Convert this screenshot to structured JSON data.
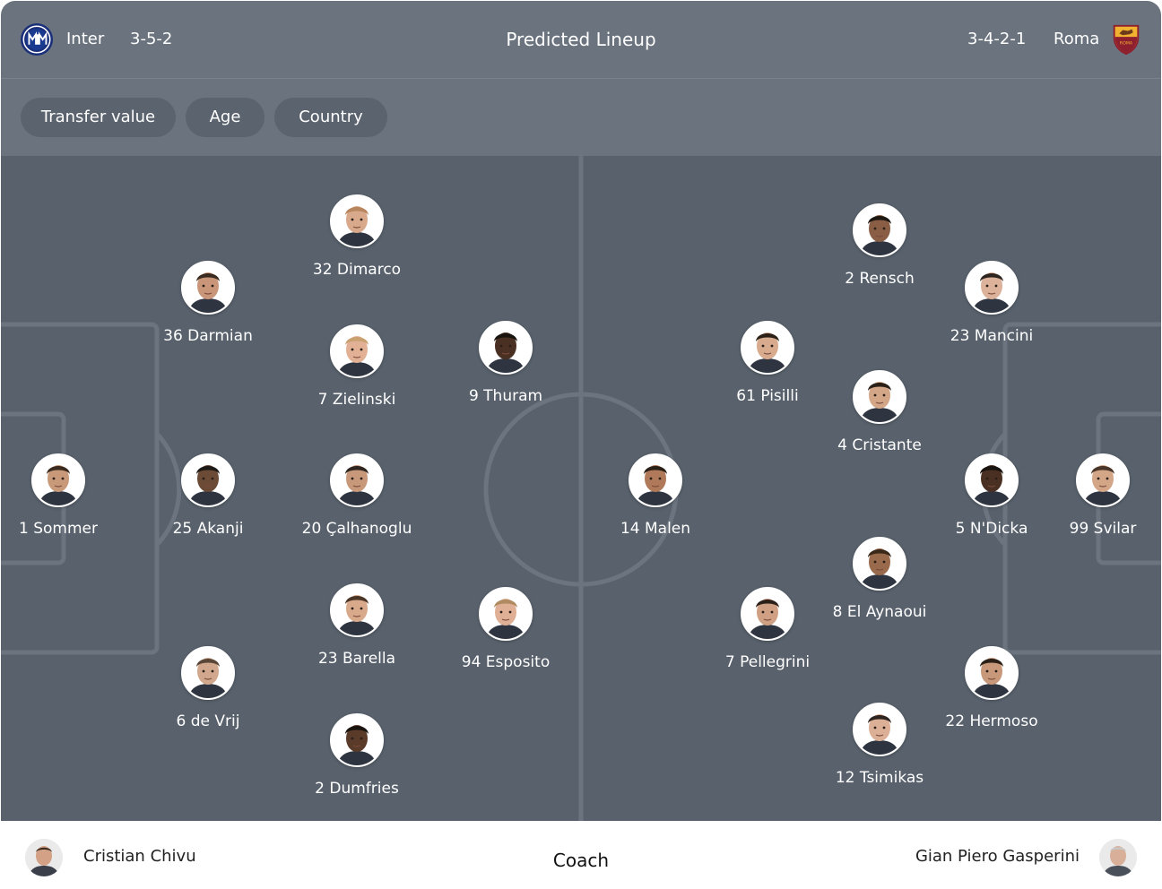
{
  "header": {
    "title": "Predicted Lineup",
    "home": {
      "name": "Inter",
      "formation": "3-5-2",
      "crest_icon": "inter-crest-icon",
      "crest_color": "#1a3a8f"
    },
    "away": {
      "name": "Roma",
      "formation": "3-4-2-1",
      "crest_icon": "roma-crest-icon",
      "crest_color": "#8e1f2f"
    }
  },
  "filters": {
    "transfer_value": "Transfer value",
    "age": "Age",
    "country": "Country"
  },
  "home_players": [
    {
      "label": "1 Sommer",
      "skin": "#c99a7a",
      "hair": "#3b2a1e"
    },
    {
      "label": "36 Darmian",
      "skin": "#c9967a",
      "hair": "#3a2a20"
    },
    {
      "label": "25 Akanji",
      "skin": "#6b4a36",
      "hair": "#1e1a18"
    },
    {
      "label": "6 de Vrij",
      "skin": "#d1a88d",
      "hair": "#5a4636"
    },
    {
      "label": "32 Dimarco",
      "skin": "#d8a98b",
      "hair": "#b8865e"
    },
    {
      "label": "7 Zielinski",
      "skin": "#e2b195",
      "hair": "#c9a070"
    },
    {
      "label": "20 Çalhanoglu",
      "skin": "#c8987a",
      "hair": "#2e2520"
    },
    {
      "label": "23 Barella",
      "skin": "#d8a98b",
      "hair": "#4a3526"
    },
    {
      "label": "2 Dumfries",
      "skin": "#5a3a28",
      "hair": "#1a1410"
    },
    {
      "label": "9 Thuram",
      "skin": "#4a3022",
      "hair": "#1a1410"
    },
    {
      "label": "94 Esposito",
      "skin": "#e0b096",
      "hair": "#b08a60"
    }
  ],
  "away_players": [
    {
      "label": "99 Svilar",
      "skin": "#d4a688",
      "hair": "#4a3628"
    },
    {
      "label": "23 Mancini",
      "skin": "#dcb29a",
      "hair": "#2e2520"
    },
    {
      "label": "5 N'Dicka",
      "skin": "#4a3022",
      "hair": "#1a1410"
    },
    {
      "label": "22 Hermoso",
      "skin": "#c8987a",
      "hair": "#2a2018"
    },
    {
      "label": "2 Rensch",
      "skin": "#8a5e44",
      "hair": "#1e1814"
    },
    {
      "label": "4 Cristante",
      "skin": "#d4a688",
      "hair": "#2a2018"
    },
    {
      "label": "8 El Aynaoui",
      "skin": "#9a6a4c",
      "hair": "#3a2818"
    },
    {
      "label": "12 Tsimikas",
      "skin": "#dcb096",
      "hair": "#2e2520"
    },
    {
      "label": "61 Pisilli",
      "skin": "#d8aa8e",
      "hair": "#2a2018"
    },
    {
      "label": "7 Pellegrini",
      "skin": "#d0a084",
      "hair": "#2a2018"
    },
    {
      "label": "14 Malen",
      "skin": "#b07a5a",
      "hair": "#2a2018"
    }
  ],
  "footer": {
    "home_coach": "Cristian Chivu",
    "coach_label": "Coach",
    "away_coach": "Gian Piero Gasperini"
  },
  "colors": {
    "header_bg": "#6a737e",
    "pill_bg": "#5a636e",
    "pitch_bg": "#58616c",
    "pitch_lines": "#6b747f"
  }
}
